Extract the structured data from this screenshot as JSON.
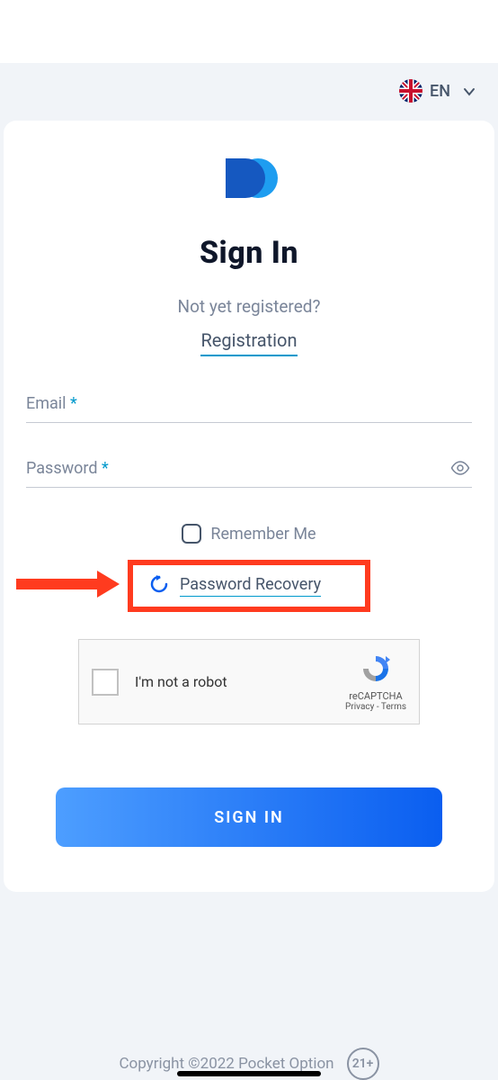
{
  "lang": {
    "label": "EN"
  },
  "page": {
    "title": "Sign In",
    "subtitle": "Not yet registered?",
    "registration_link": "Registration"
  },
  "fields": {
    "email": {
      "label": "Email",
      "required": "*"
    },
    "password": {
      "label": "Password",
      "required": "*"
    }
  },
  "remember": {
    "label": "Remember Me"
  },
  "recovery": {
    "label": "Password Recovery"
  },
  "recaptcha": {
    "label": "I'm not a robot",
    "brand": "reCAPTCHA",
    "privacy": "Privacy",
    "sep": " - ",
    "terms": "Terms"
  },
  "signin_button": "SIGN IN",
  "footer": {
    "copyright": "Copyright ©2022 Pocket Option",
    "age": "21+"
  }
}
